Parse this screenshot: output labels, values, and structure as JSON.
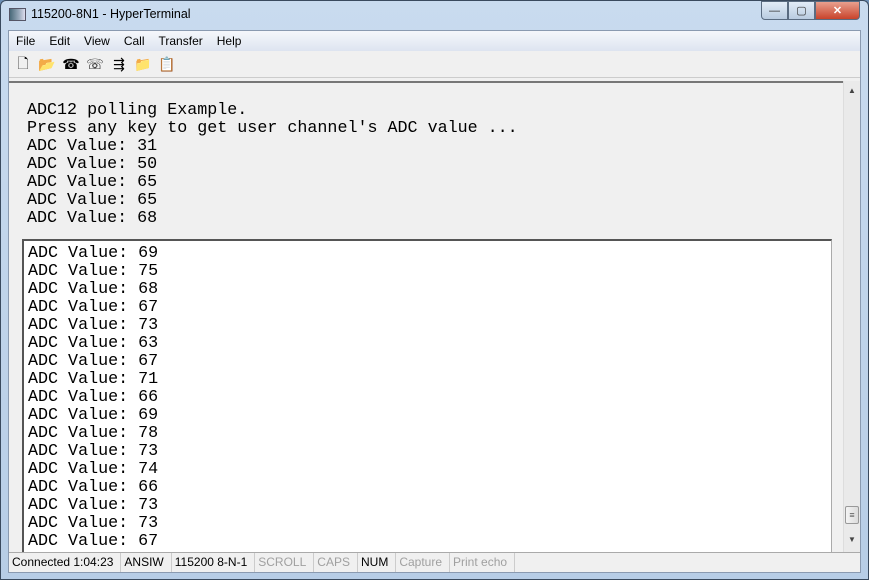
{
  "window": {
    "title": "115200-8N1 - HyperTerminal",
    "minimize": "—",
    "maximize": "▢",
    "close": "✕"
  },
  "menu": [
    "File",
    "Edit",
    "View",
    "Call",
    "Transfer",
    "Help"
  ],
  "toolbar": [
    {
      "icon": "new-file-icon",
      "glyph": "🗋"
    },
    {
      "icon": "open-folder-icon",
      "glyph": "📂"
    },
    {
      "icon": "disconnect-phone-icon",
      "glyph": "☎"
    },
    {
      "icon": "dial-phone-icon",
      "glyph": "☏"
    },
    {
      "icon": "send-file-icon",
      "glyph": "⇶"
    },
    {
      "icon": "receive-file-icon",
      "glyph": "📁"
    },
    {
      "icon": "properties-icon",
      "glyph": "📋"
    }
  ],
  "terminal": {
    "backscroll": [
      "ADC12 polling Example.",
      "Press any key to get user channel's ADC value ...",
      "ADC Value: 31",
      "ADC Value: 50",
      "ADC Value: 65",
      "ADC Value: 65",
      "ADC Value: 68"
    ],
    "screen": [
      "ADC Value: 69",
      "ADC Value: 75",
      "ADC Value: 68",
      "ADC Value: 67",
      "ADC Value: 73",
      "ADC Value: 63",
      "ADC Value: 67",
      "ADC Value: 71",
      "ADC Value: 66",
      "ADC Value: 69",
      "ADC Value: 78",
      "ADC Value: 73",
      "ADC Value: 74",
      "ADC Value: 66",
      "ADC Value: 73",
      "ADC Value: 73",
      "ADC Value: 67"
    ]
  },
  "status": [
    {
      "text": "Connected 1:04:23",
      "active": true
    },
    {
      "text": "ANSIW",
      "active": true
    },
    {
      "text": "115200 8-N-1",
      "active": true
    },
    {
      "text": "SCROLL",
      "active": false
    },
    {
      "text": "CAPS",
      "active": false
    },
    {
      "text": "NUM",
      "active": true
    },
    {
      "text": "Capture",
      "active": false
    },
    {
      "text": "Print echo",
      "active": false
    }
  ]
}
